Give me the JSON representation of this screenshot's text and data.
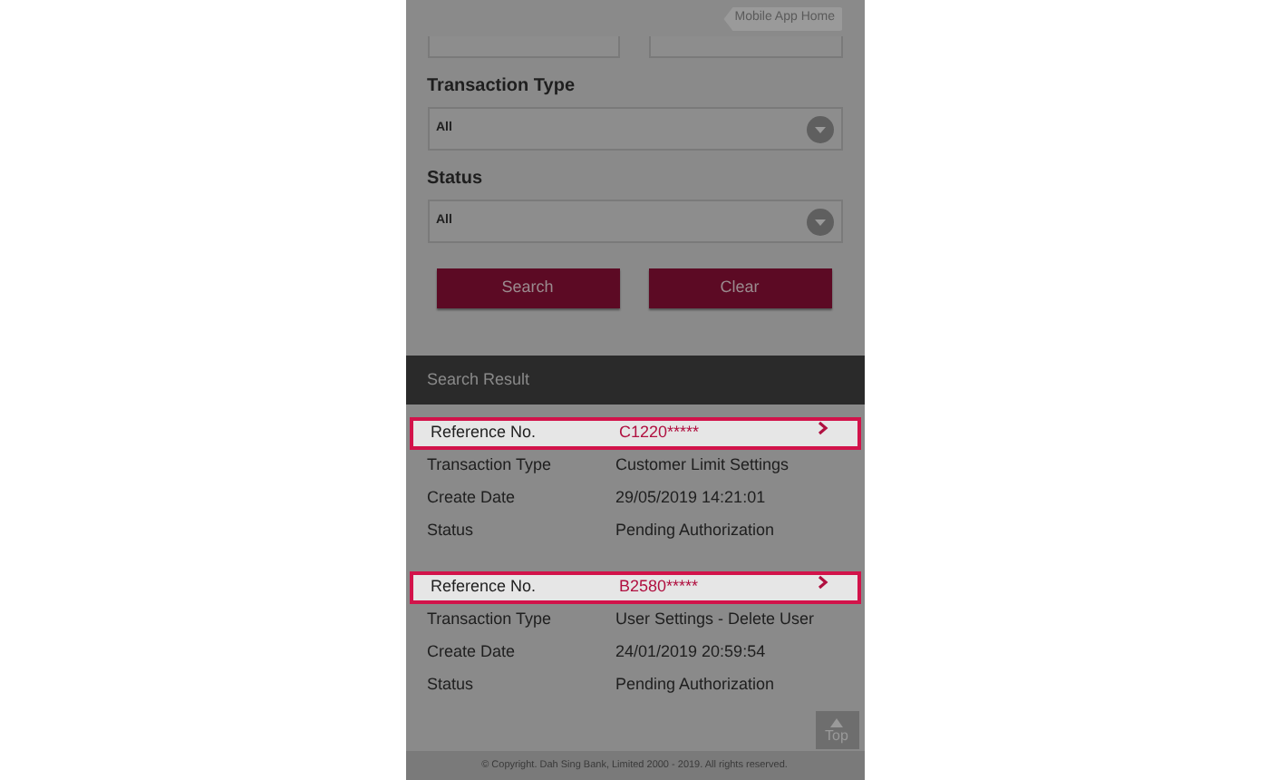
{
  "header": {
    "home_link": "Mobile App Home"
  },
  "filters": [
    {
      "label": "Transaction Type",
      "value": "All"
    },
    {
      "label": "Status",
      "value": "All"
    }
  ],
  "buttons": [
    "Search",
    "Clear"
  ],
  "results": {
    "title": "Search Result",
    "items": [
      {
        "highlighted": true,
        "fields": [
          {
            "label": "Reference No.",
            "value": "C1220*****"
          },
          {
            "label": "Transaction Type",
            "value": "Customer Limit Settings"
          },
          {
            "label": "Create Date",
            "value": "29/05/2019 14:21:01"
          },
          {
            "label": "Status",
            "value": "Pending Authorization"
          }
        ]
      },
      {
        "highlighted": true,
        "fields": [
          {
            "label": "Reference No.",
            "value": "B2580*****"
          },
          {
            "label": "Transaction Type",
            "value": "User Settings - Delete User"
          },
          {
            "label": "Create Date",
            "value": "24/01/2019 20:59:54"
          },
          {
            "label": "Status",
            "value": "Pending Authorization"
          }
        ]
      }
    ]
  },
  "top_button": "Top",
  "footer": "© Copyright. Dah Sing Bank, Limited 2000 - 2019. All rights reserved."
}
